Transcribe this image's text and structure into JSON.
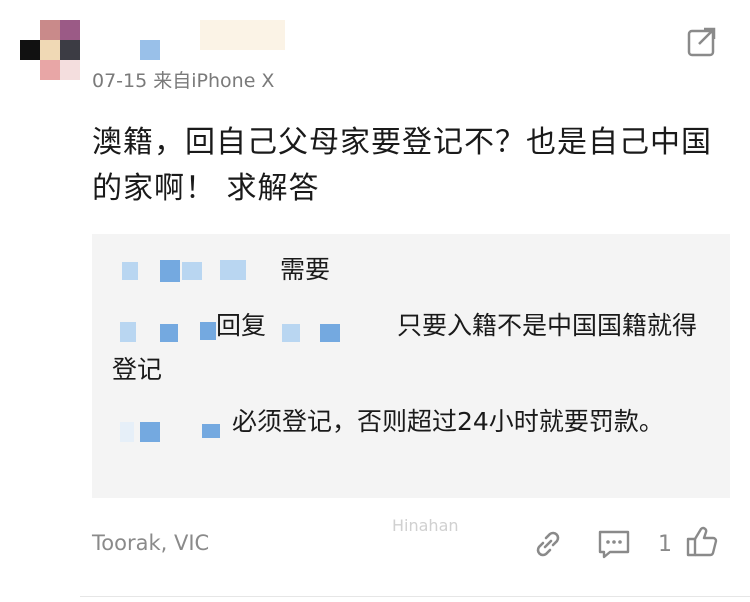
{
  "comment": {
    "meta": "07-15 来自iPhone X",
    "text": "澳籍，回自己父母家要登记不？也是自己中国的家啊！ 求解答"
  },
  "replies": [
    {
      "text": "需要"
    },
    {
      "reply_label": "回复",
      "text": "只要入籍不是中国国籍就得登记"
    },
    {
      "text": "必须登记，否则超过24小时就要罚款。"
    }
  ],
  "watermark": "Hinahan",
  "footer": {
    "location": "Toorak, VIC",
    "like_count": "1"
  },
  "icons": [
    "link-icon",
    "comment-icon",
    "thumbs-up-icon",
    "share-icon"
  ],
  "colors": {
    "icon": "#8a8a8a",
    "reply_bg": "#f4f4f4",
    "meta_text": "#7a7a7a"
  }
}
